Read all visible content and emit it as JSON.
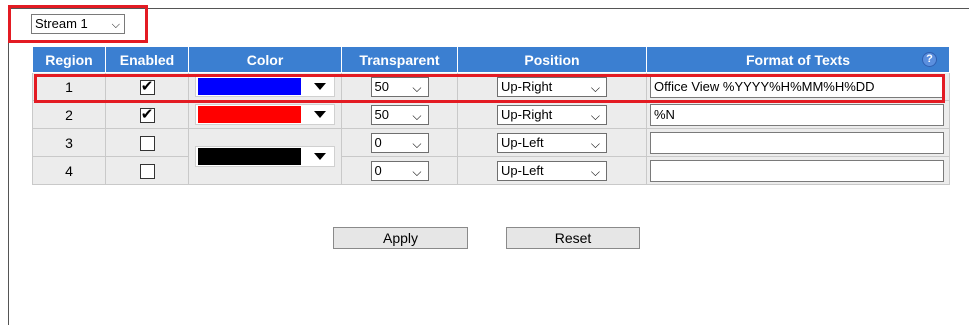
{
  "stream_select": {
    "value": "Stream 1"
  },
  "table": {
    "headers": {
      "region": "Region",
      "enabled": "Enabled",
      "color": "Color",
      "transparent": "Transparent",
      "position": "Position",
      "format": "Format of Texts"
    },
    "help_glyph": "?",
    "rows": [
      {
        "region": "1",
        "enabled": true,
        "color": "#0000ff",
        "transparent": "50",
        "position": "Up-Right",
        "format": "Office View %YYYY%H%MM%H%DD"
      },
      {
        "region": "2",
        "enabled": true,
        "color": "#ff0000",
        "transparent": "50",
        "position": "Up-Right",
        "format": "%N"
      },
      {
        "region": "3",
        "enabled": false,
        "color": "#000000",
        "transparent": "0",
        "position": "Up-Left",
        "format": ""
      },
      {
        "region": "4",
        "enabled": false,
        "color": "#000000",
        "transparent": "0",
        "position": "Up-Left",
        "format": ""
      }
    ]
  },
  "buttons": {
    "apply": "Apply",
    "reset": "Reset"
  },
  "checkmark_glyph": "✔",
  "chevron_glyph": "⌵",
  "colors": {
    "header_bg": "#3b7fd1",
    "highlight": "#e31b23",
    "row_bg": "#ececec"
  }
}
